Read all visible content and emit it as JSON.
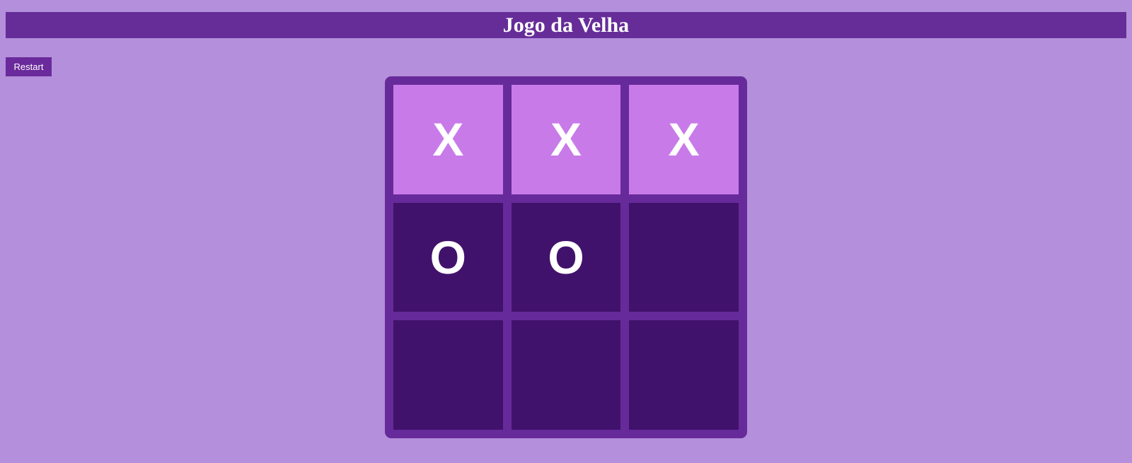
{
  "header": {
    "title": "Jogo da Velha"
  },
  "controls": {
    "restart_label": "Restart"
  },
  "board": {
    "cells": [
      "X",
      "X",
      "X",
      "O",
      "O",
      "",
      "",
      "",
      ""
    ],
    "winning_cells": [
      0,
      1,
      2
    ]
  },
  "colors": {
    "background": "#b48fdb",
    "header": "#662d99",
    "board_frame": "#672a9a",
    "cell": "#41126b",
    "winning_cell": "#c87be8",
    "mark": "#ffffff"
  }
}
